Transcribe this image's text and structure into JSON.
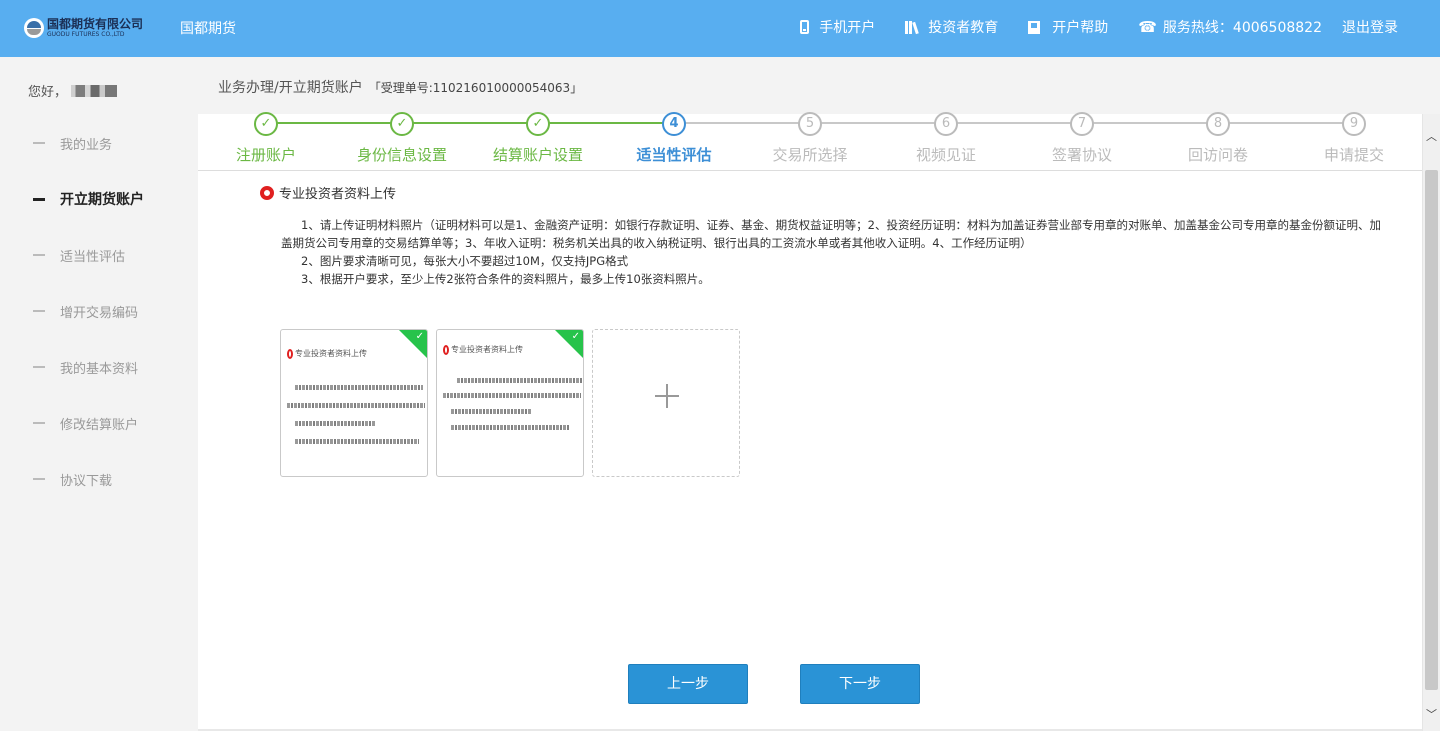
{
  "header": {
    "logo_cn": "国都期货有限公司",
    "logo_en": "GUODU FUTURES CO.,LTD",
    "brand": "国都期货",
    "nav": [
      {
        "icon": "phone-icon",
        "label": "手机开户"
      },
      {
        "icon": "books-icon",
        "label": "投资者教育"
      },
      {
        "icon": "help-icon",
        "label": "开户帮助"
      },
      {
        "icon": "telephone-icon",
        "label": "服务热线：4006508822"
      }
    ],
    "logout": "退出登录"
  },
  "sidebar": {
    "greeting": "您好，",
    "items": [
      {
        "label": "我的业务",
        "active": false
      },
      {
        "label": "开立期货账户",
        "active": true
      },
      {
        "label": "适当性评估",
        "active": false
      },
      {
        "label": "增开交易编码",
        "active": false
      },
      {
        "label": "我的基本资料",
        "active": false
      },
      {
        "label": "修改结算账户",
        "active": false
      },
      {
        "label": "协议下载",
        "active": false
      }
    ]
  },
  "breadcrumb": {
    "path": "业务办理/开立期货账户",
    "ticket": "「受理单号:110216010000054063」"
  },
  "steps": [
    {
      "num": "✓",
      "label": "注册账户",
      "state": "done"
    },
    {
      "num": "✓",
      "label": "身份信息设置",
      "state": "done"
    },
    {
      "num": "✓",
      "label": "结算账户设置",
      "state": "done"
    },
    {
      "num": "4",
      "label": "适当性评估",
      "state": "current"
    },
    {
      "num": "5",
      "label": "交易所选择",
      "state": "todo"
    },
    {
      "num": "6",
      "label": "视频见证",
      "state": "todo"
    },
    {
      "num": "7",
      "label": "签署协议",
      "state": "todo"
    },
    {
      "num": "8",
      "label": "回访问卷",
      "state": "todo"
    },
    {
      "num": "9",
      "label": "申请提交",
      "state": "todo"
    }
  ],
  "colors": {
    "header": "#58aef0",
    "done": "#6bb844",
    "current": "#3d8fd6",
    "todo": "#bbbbbb",
    "check": "#27c34b",
    "button": "#2a93d6"
  },
  "section": {
    "title": "专业投资者资料上传",
    "instructions": [
      "1、请上传证明材料照片（证明材料可以是1、金融资产证明：如银行存款证明、证券、基金、期货权益证明等；2、投资经历证明：材料为加盖证券营业部专用章的对账单、加盖基金公司专用章的基金份额证明、加盖期货公司专用章的交易结算单等；3、年收入证明：税务机关出具的收入纳税证明、银行出具的工资流水单或者其他收入证明。4、工作经历证明）",
      "2、图片要求清晰可见，每张大小不要超过10M，仅支持JPG格式",
      "3、根据开户要求，至少上传2张符合条件的资料照片，最多上传10张资料照片。"
    ]
  },
  "uploads": {
    "thumbnail_title": "专业投资者资料上传",
    "checkmark": "✓",
    "add_label": "+"
  },
  "buttons": {
    "prev": "上一步",
    "next": "下一步"
  },
  "scrollbar": {
    "up": "︿",
    "down": "﹀"
  }
}
